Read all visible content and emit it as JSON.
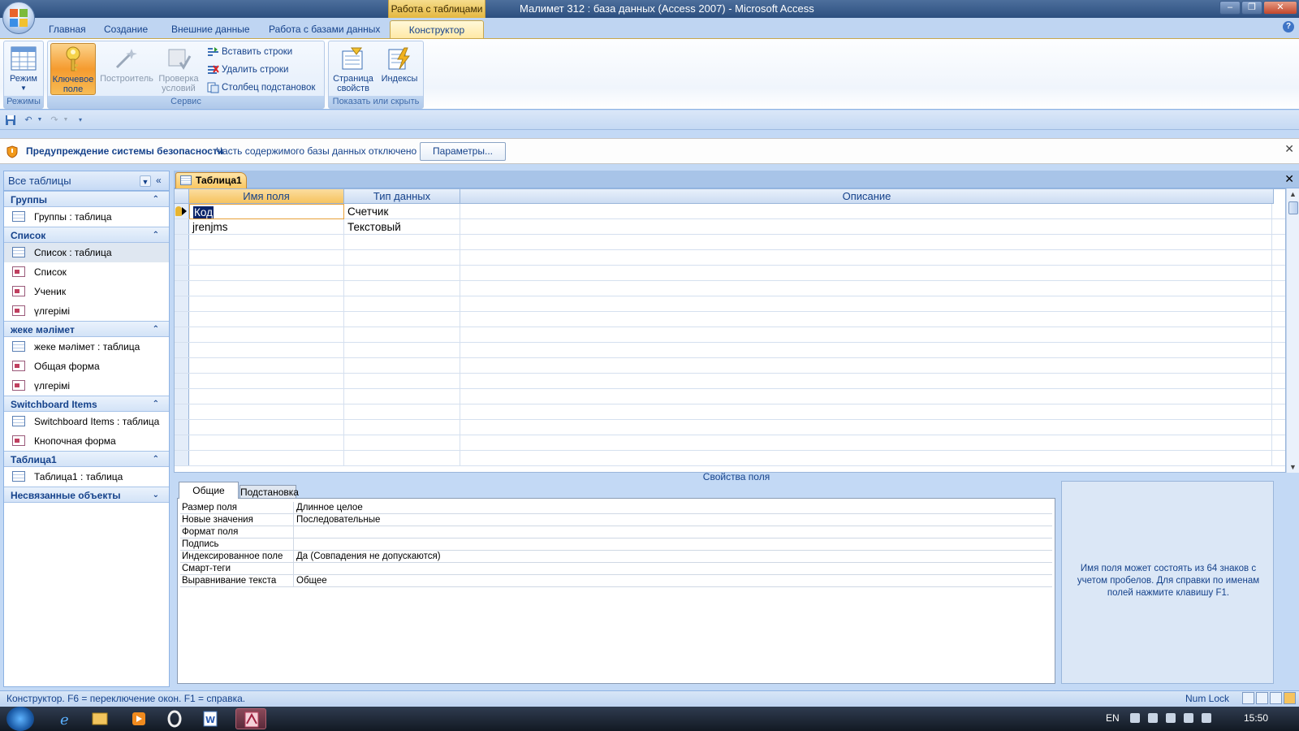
{
  "window": {
    "title": "Малимет 312 : база данных (Access 2007)  -  Microsoft Access",
    "context_tab_title": "Работа с таблицами",
    "controls": [
      "–",
      "❐",
      "✕"
    ]
  },
  "ribbon_tabs": [
    "Главная",
    "Создание",
    "Внешние данные",
    "Работа с базами данных",
    "Конструктор"
  ],
  "ribbon": {
    "groups": {
      "modes": {
        "label": "Режимы",
        "btn_mode": "Режим"
      },
      "service": {
        "label": "Сервис",
        "btn_key_line1": "Ключевое",
        "btn_key_line2": "поле",
        "btn_builder": "Построитель",
        "btn_validate_line1": "Проверка",
        "btn_validate_line2": "условий",
        "insert_rows": "Вставить строки",
        "delete_rows": "Удалить строки",
        "lookup_column": "Столбец  подстановок"
      },
      "show_hide": {
        "label": "Показать или скрыть",
        "btn_props_line1": "Страница",
        "btn_props_line2": "свойств",
        "btn_indexes": "Индексы"
      }
    }
  },
  "security": {
    "title": "Предупреждение системы безопасности",
    "message": "Часть содержимого базы данных отключено",
    "button": "Параметры..."
  },
  "nav": {
    "header": "Все таблицы",
    "groups": [
      {
        "title": "Группы",
        "items": [
          {
            "label": "Группы : таблица",
            "kind": "table"
          }
        ]
      },
      {
        "title": "Список",
        "items": [
          {
            "label": "Список : таблица",
            "kind": "table"
          },
          {
            "label": "Список",
            "kind": "form"
          },
          {
            "label": "Ученик",
            "kind": "form"
          },
          {
            "label": "үлгерімі",
            "kind": "form"
          }
        ]
      },
      {
        "title": "жеке мәлімет",
        "items": [
          {
            "label": "жеке мәлімет : таблица",
            "kind": "table"
          },
          {
            "label": "Общая форма",
            "kind": "form"
          },
          {
            "label": "үлгерімі",
            "kind": "form"
          }
        ]
      },
      {
        "title": "Switchboard Items",
        "items": [
          {
            "label": "Switchboard Items : таблица",
            "kind": "table"
          },
          {
            "label": "Кнопочная форма",
            "kind": "form"
          }
        ]
      },
      {
        "title": "Таблица1",
        "items": [
          {
            "label": "Таблица1 : таблица",
            "kind": "table"
          }
        ]
      },
      {
        "title": "Несвязанные объекты",
        "items": []
      }
    ]
  },
  "document": {
    "tab_title": "Таблица1",
    "columns": [
      "Имя поля",
      "Тип данных",
      "Описание"
    ],
    "rows": [
      {
        "name": "Код",
        "type": "Счетчик",
        "desc": ""
      },
      {
        "name": "jrenjms",
        "type": "Текстовый",
        "desc": ""
      }
    ],
    "props_title": "Свойства поля",
    "props_tabs": [
      "Общие",
      "Подстановка"
    ],
    "props": [
      {
        "label": "Размер поля",
        "value": "Длинное целое"
      },
      {
        "label": "Новые значения",
        "value": "Последовательные"
      },
      {
        "label": "Формат поля",
        "value": ""
      },
      {
        "label": "Подпись",
        "value": ""
      },
      {
        "label": "Индексированное поле",
        "value": "Да (Совпадения не допускаются)"
      },
      {
        "label": "Смарт-теги",
        "value": ""
      },
      {
        "label": "Выравнивание текста",
        "value": "Общее"
      }
    ],
    "help_text": "Имя поля может состоять из 64 знаков с учетом пробелов.  Для справки по именам полей нажмите клавишу F1."
  },
  "status": {
    "left": "Конструктор.  F6 = переключение окон.  F1 = справка.",
    "numlock": "Num Lock"
  },
  "taskbar": {
    "lang": "EN",
    "time": "15:50"
  }
}
